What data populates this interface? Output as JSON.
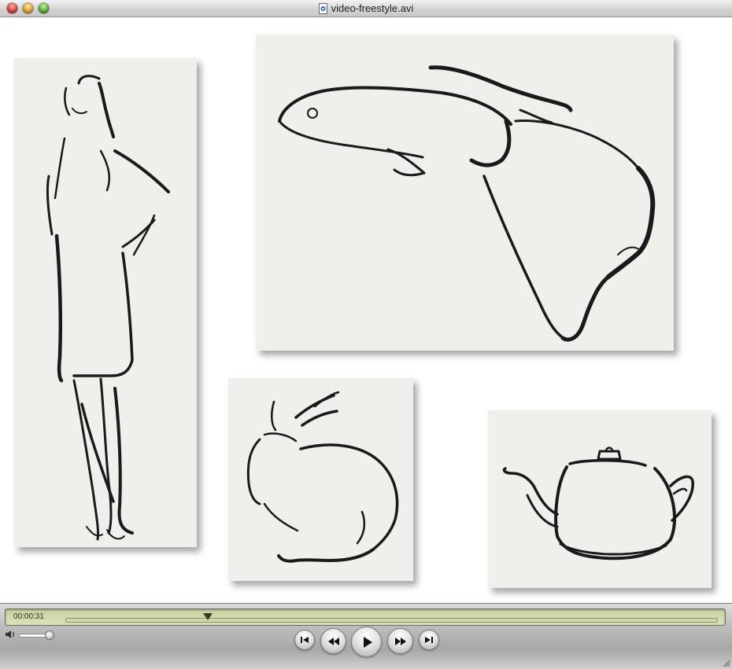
{
  "window": {
    "title": "video-freestyle.avi"
  },
  "player": {
    "current_time": "00:00:31",
    "playhead_fraction": 0.22,
    "volume_fraction": 1.0
  },
  "controls": {
    "buttons": [
      "skip-to-start",
      "rewind",
      "play",
      "fast-forward",
      "skip-to-end"
    ]
  },
  "video_frame": {
    "sketches": [
      "standing-woman",
      "fish",
      "rabbit",
      "teapot"
    ]
  }
}
